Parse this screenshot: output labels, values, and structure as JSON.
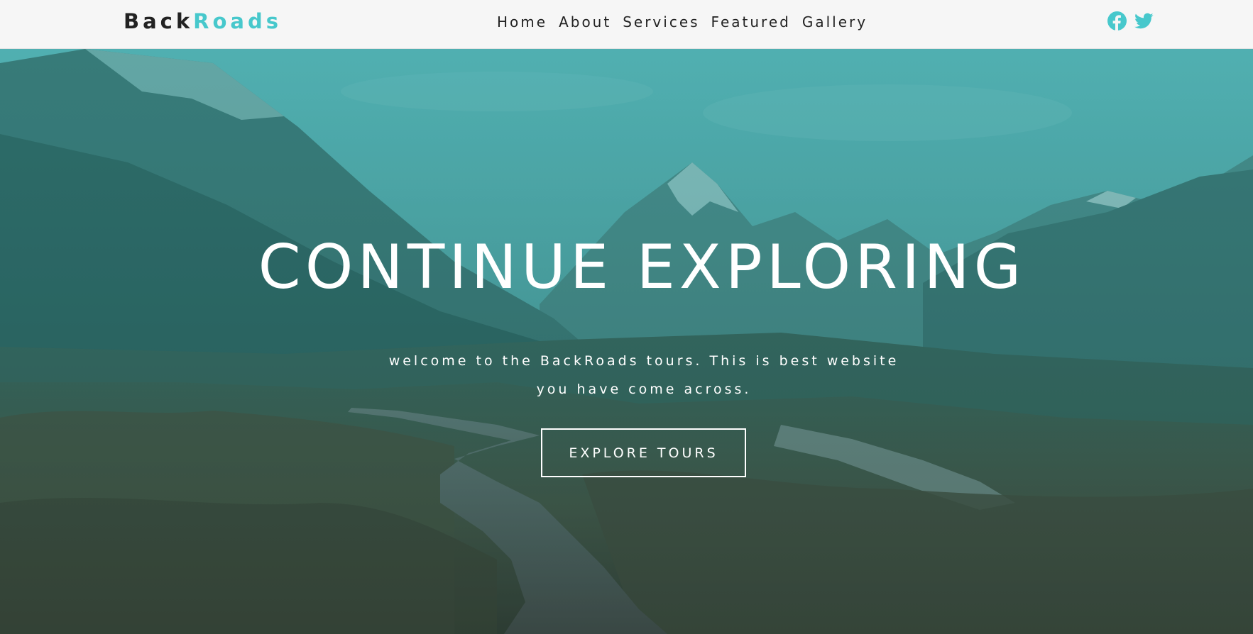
{
  "brand": {
    "part1": "Back",
    "part2": "Roads",
    "accent_color": "#47c8cc"
  },
  "nav": {
    "links": [
      "Home",
      "About",
      "Services",
      "Featured",
      "Gallery"
    ]
  },
  "socials": [
    {
      "icon": "facebook-icon"
    },
    {
      "icon": "twitter-icon"
    }
  ],
  "hero": {
    "title": "CONTINUE EXPLORING",
    "text_line1": "welcome to the BackRoads tours. This is best website",
    "text_line2": "you have come across.",
    "button_label": "EXPLORE TOURS",
    "overlay_color": "#47c8cc"
  }
}
